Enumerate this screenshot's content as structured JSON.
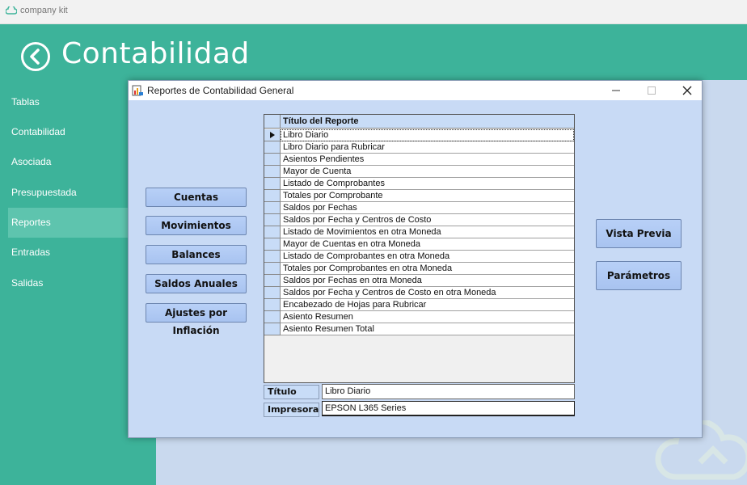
{
  "app": {
    "title": "company kit",
    "heading": "Contabilidad"
  },
  "sidebar": {
    "items": [
      {
        "label": "Tablas"
      },
      {
        "label": "Contabilidad"
      },
      {
        "label": "Asociada"
      },
      {
        "label": "Presupuestada"
      },
      {
        "label": "Reportes",
        "active": true
      },
      {
        "label": "Entradas"
      },
      {
        "label": "Salidas"
      }
    ]
  },
  "dialog": {
    "title": "Reportes de Contabilidad General",
    "left_buttons": [
      {
        "label": "Cuentas"
      },
      {
        "label": "Movimientos"
      },
      {
        "label": "Balances"
      },
      {
        "label": "Saldos Anuales"
      },
      {
        "label": "Ajustes por Inflación"
      }
    ],
    "right_buttons": [
      {
        "label": "Vista Previa"
      },
      {
        "label": "Parámetros"
      }
    ],
    "grid": {
      "header": "Título del Reporte",
      "rows": [
        "Libro Diario",
        "Libro Diario para Rubricar",
        "Asientos Pendientes",
        "Mayor de Cuenta",
        "Listado de Comprobantes",
        "Totales por Comprobante",
        "Saldos por Fechas",
        "Saldos por Fecha y Centros de Costo",
        "Listado de Movimientos en otra Moneda",
        "Mayor de Cuentas en otra Moneda",
        "Listado de Comprobantes en otra Moneda",
        "Totales por Comprobantes en otra Moneda",
        "Saldos por Fechas en otra Moneda",
        "Saldos por Fecha y Centros de Costo en otra Moneda",
        "Encabezado de Hojas para Rubricar",
        "Asiento Resumen",
        "Asiento Resumen Total"
      ]
    },
    "fields": {
      "titulo_label": "Título",
      "titulo_value": "Libro Diario",
      "impresora_label": "Impresora",
      "impresora_value": "EPSON L365 Series"
    }
  }
}
